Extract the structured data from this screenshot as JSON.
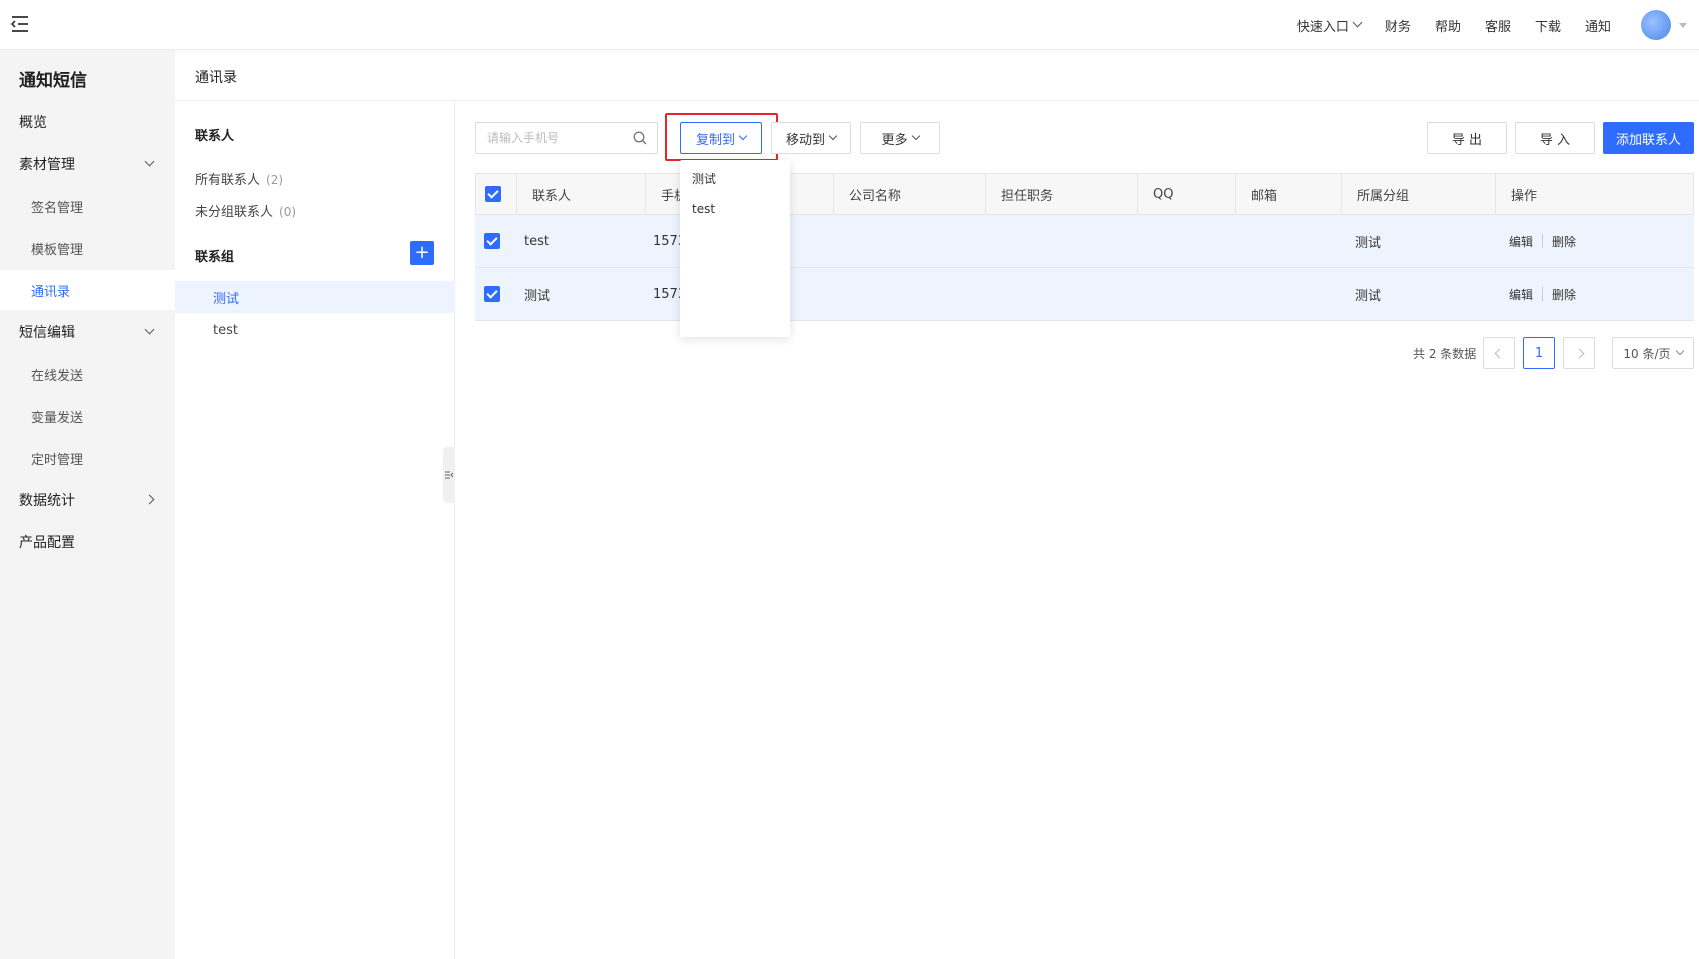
{
  "topbar": {
    "menu_icon": "menu-fold-icon",
    "links": [
      "快速入口",
      "财务",
      "帮助",
      "客服",
      "下载",
      "通知"
    ],
    "avatar_color": "#4a86e8"
  },
  "sidebar": {
    "title": "通知短信",
    "items": [
      {
        "label": "概览"
      },
      {
        "label": "素材管理"
      },
      {
        "label": "签名管理"
      },
      {
        "label": "模板管理"
      },
      {
        "label": "通讯录"
      },
      {
        "label": "短信编辑"
      },
      {
        "label": "在线发送"
      },
      {
        "label": "变量发送"
      },
      {
        "label": "定时管理"
      },
      {
        "label": "数据统计"
      },
      {
        "label": "产品配置"
      }
    ]
  },
  "breadcrumb": "通讯录",
  "groups": {
    "contacts_heading": "联系人",
    "all_contacts": {
      "label": "所有联系人",
      "count": "(2)"
    },
    "ungrouped": {
      "label": "未分组联系人",
      "count": "(0)"
    },
    "groups_heading": "联系组",
    "add_label": "+",
    "list": [
      {
        "label": "测试"
      },
      {
        "label": "test"
      }
    ]
  },
  "toolbar": {
    "search_placeholder": "请输入手机号",
    "copy_label": "复制到",
    "move_label": "移动到",
    "more_label": "更多",
    "export_label": "导 出",
    "import_label": "导 入",
    "add_contact_label": "添加联系人"
  },
  "copy_dropdown": {
    "options": [
      "测试",
      "test"
    ]
  },
  "table": {
    "columns": [
      "联系人",
      "手机",
      "公司名称",
      "担任职务",
      "QQ",
      "邮箱",
      "所属分组",
      "操作"
    ],
    "rows": [
      {
        "name": "test",
        "phone": "1573",
        "group": "测试",
        "edit": "编辑",
        "delete": "删除"
      },
      {
        "name": "测试",
        "phone": "1573",
        "group": "测试",
        "edit": "编辑",
        "delete": "删除"
      }
    ]
  },
  "pagination": {
    "total": "共 2 条数据",
    "current": "1",
    "page_size": "10 条/页"
  },
  "colors": {
    "primary": "#2f6bff",
    "highlight": "#e8262a"
  }
}
